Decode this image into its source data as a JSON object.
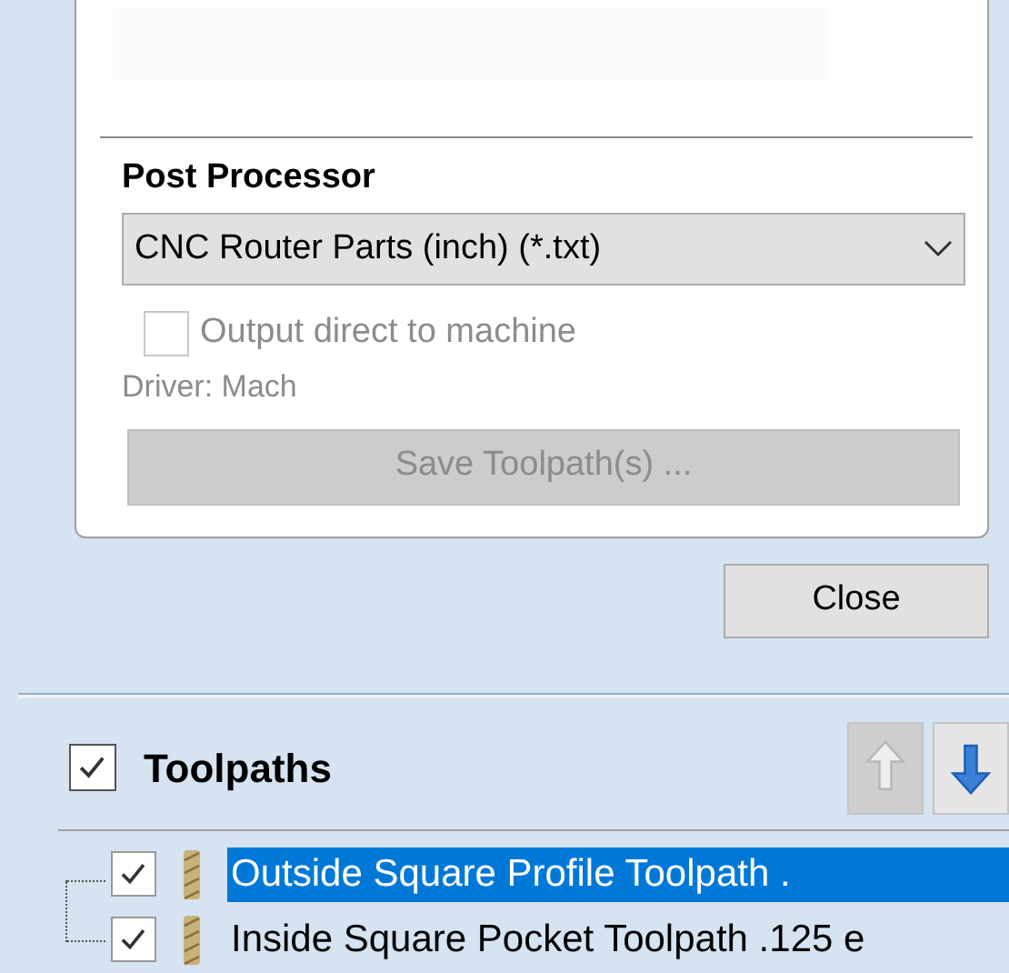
{
  "post_processor": {
    "heading": "Post Processor",
    "dropdown": {
      "value": "CNC Router Parts (inch) (*.txt)"
    },
    "output_direct": {
      "label": "Output direct to machine",
      "checked": false,
      "disabled": true
    },
    "driver": "Driver: Mach",
    "save_button": {
      "label": "Save Toolpath(s) ...",
      "disabled": true
    }
  },
  "close_button": "Close",
  "toolpaths": {
    "title": "Toolpaths",
    "checked": true,
    "move_up": {
      "disabled": true
    },
    "move_down": {
      "disabled": false
    },
    "items": [
      {
        "label": "Outside Square Profile Toolpath .",
        "checked": true,
        "selected": true
      },
      {
        "label": "Inside Square Pocket Toolpath .125 e",
        "checked": true,
        "selected": false
      }
    ]
  }
}
